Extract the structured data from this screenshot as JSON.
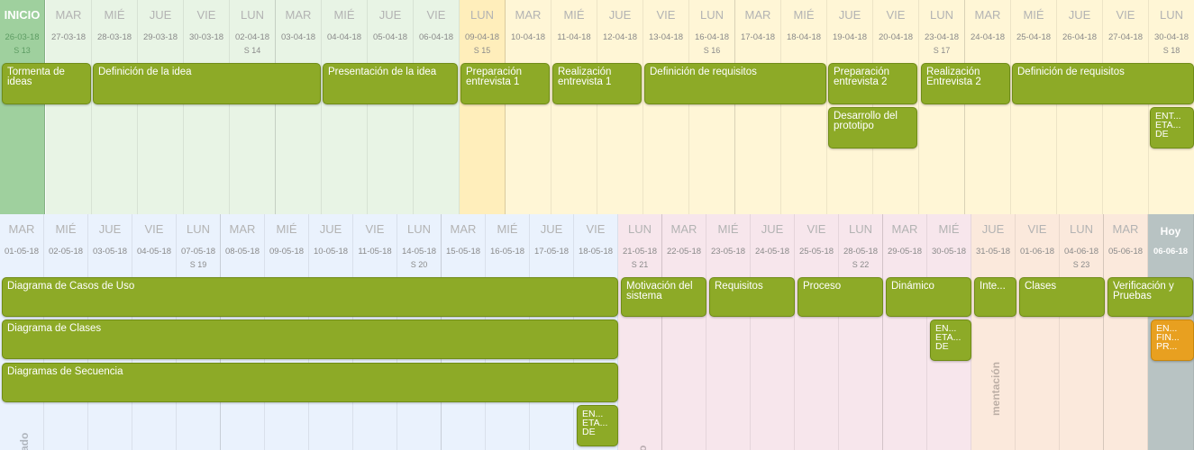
{
  "colors": {
    "start_col": "#9fd09e",
    "phase_green": "#e8f4e5",
    "phase_yellow": "#fff6d6",
    "phase_blue": "#eaf2fd",
    "phase_pink": "#f7e6ec",
    "phase_peach": "#fbe9dc",
    "today_col": "#b8c3c3",
    "task_green": "#8daa27",
    "task_orange": "#e8a020"
  },
  "band1": {
    "columns": [
      {
        "day": "INICIO",
        "date": "26-03-18",
        "week": "S 13",
        "special": "start"
      },
      {
        "day": "MAR",
        "date": "27-03-18"
      },
      {
        "day": "MIÉ",
        "date": "28-03-18"
      },
      {
        "day": "JUE",
        "date": "29-03-18"
      },
      {
        "day": "VIE",
        "date": "30-03-18"
      },
      {
        "day": "LUN",
        "date": "02-04-18",
        "week": "S 14"
      },
      {
        "day": "MAR",
        "date": "03-04-18"
      },
      {
        "day": "MIÉ",
        "date": "04-04-18"
      },
      {
        "day": "JUE",
        "date": "05-04-18"
      },
      {
        "day": "VIE",
        "date": "06-04-18"
      },
      {
        "day": "LUN",
        "date": "09-04-18",
        "week": "S 15",
        "highlight": true
      },
      {
        "day": "MAR",
        "date": "10-04-18"
      },
      {
        "day": "MIÉ",
        "date": "11-04-18"
      },
      {
        "day": "JUE",
        "date": "12-04-18"
      },
      {
        "day": "VIE",
        "date": "13-04-18"
      },
      {
        "day": "LUN",
        "date": "16-04-18",
        "week": "S 16"
      },
      {
        "day": "MAR",
        "date": "17-04-18"
      },
      {
        "day": "MIÉ",
        "date": "18-04-18"
      },
      {
        "day": "JUE",
        "date": "19-04-18"
      },
      {
        "day": "VIE",
        "date": "20-04-18"
      },
      {
        "day": "LUN",
        "date": "23-04-18",
        "week": "S 17"
      },
      {
        "day": "MAR",
        "date": "24-04-18"
      },
      {
        "day": "MIÉ",
        "date": "25-04-18"
      },
      {
        "day": "JUE",
        "date": "26-04-18"
      },
      {
        "day": "VIE",
        "date": "27-04-18"
      },
      {
        "day": "LUN",
        "date": "30-04-18",
        "week": "S 18"
      }
    ],
    "tasks": [
      {
        "label": "Tormenta de ideas"
      },
      {
        "label": "Definición de la idea"
      },
      {
        "label": "Presentación de la idea"
      },
      {
        "label": "Preparación entrevista 1"
      },
      {
        "label": "Realización entrevista 1"
      },
      {
        "label": "Definición de requisitos"
      },
      {
        "label": "Preparación entrevista 2"
      },
      {
        "label": "Realización Entrevista 2"
      },
      {
        "label": "Definición de requisitos"
      },
      {
        "label": "Desarrollo del prototipo"
      },
      {
        "label": "ENT... ETA... DE"
      }
    ]
  },
  "band2": {
    "columns": [
      {
        "day": "MAR",
        "date": "01-05-18"
      },
      {
        "day": "MIÉ",
        "date": "02-05-18"
      },
      {
        "day": "JUE",
        "date": "03-05-18"
      },
      {
        "day": "VIE",
        "date": "04-05-18"
      },
      {
        "day": "LUN",
        "date": "07-05-18",
        "week": "S 19"
      },
      {
        "day": "MAR",
        "date": "08-05-18"
      },
      {
        "day": "MIÉ",
        "date": "09-05-18"
      },
      {
        "day": "JUE",
        "date": "10-05-18"
      },
      {
        "day": "VIE",
        "date": "11-05-18"
      },
      {
        "day": "LUN",
        "date": "14-05-18",
        "week": "S 20"
      },
      {
        "day": "MAR",
        "date": "15-05-18"
      },
      {
        "day": "MIÉ",
        "date": "16-05-18"
      },
      {
        "day": "JUE",
        "date": "17-05-18"
      },
      {
        "day": "VIE",
        "date": "18-05-18"
      },
      {
        "day": "LUN",
        "date": "21-05-18",
        "week": "S 21"
      },
      {
        "day": "MAR",
        "date": "22-05-18"
      },
      {
        "day": "MIÉ",
        "date": "23-05-18"
      },
      {
        "day": "JUE",
        "date": "24-05-18"
      },
      {
        "day": "VIE",
        "date": "25-05-18"
      },
      {
        "day": "LUN",
        "date": "28-05-18",
        "week": "S 22"
      },
      {
        "day": "MAR",
        "date": "29-05-18"
      },
      {
        "day": "MIÉ",
        "date": "30-05-18"
      },
      {
        "day": "JUE",
        "date": "31-05-18"
      },
      {
        "day": "VIE",
        "date": "01-06-18"
      },
      {
        "day": "LUN",
        "date": "04-06-18",
        "week": "S 23"
      },
      {
        "day": "MAR",
        "date": "05-06-18"
      },
      {
        "day": "Hoy",
        "date": "06-06-18",
        "special": "today"
      }
    ],
    "tasks": [
      {
        "label": "Diagrama de Casos de Uso"
      },
      {
        "label": "Diagrama de Clases"
      },
      {
        "label": "Diagramas de Secuencia"
      },
      {
        "label": "EN... ETA... DE"
      },
      {
        "label": "Motivación del sistema"
      },
      {
        "label": "Requisitos"
      },
      {
        "label": "Proceso"
      },
      {
        "label": "Dinámico"
      },
      {
        "label": "Inte..."
      },
      {
        "label": "Clases"
      },
      {
        "label": "Verificación y Pruebas"
      },
      {
        "label": "EN... ETA... DE"
      },
      {
        "label": "EN... FIN... PR..."
      }
    ],
    "phase_labels": [
      {
        "text": "ado"
      },
      {
        "text": "o"
      },
      {
        "text": "mentación"
      }
    ]
  }
}
